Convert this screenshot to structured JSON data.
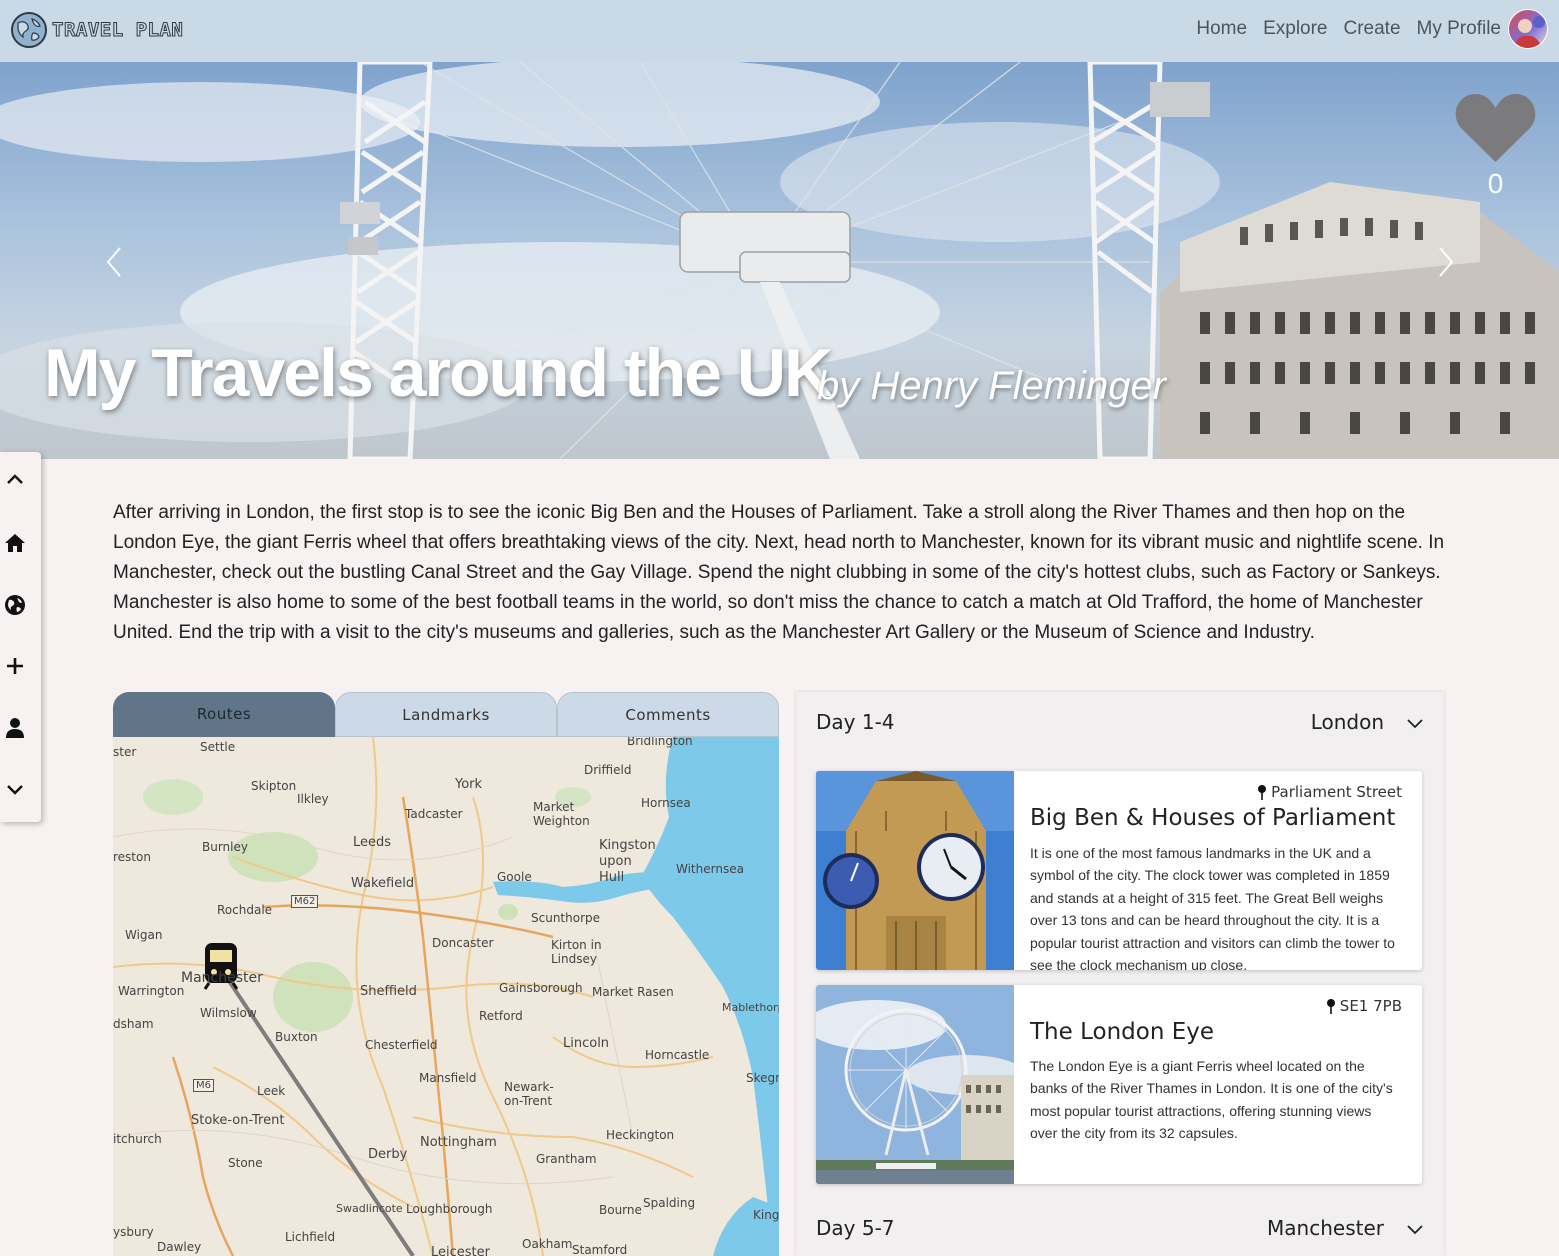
{
  "app": {
    "name": "TRAVEL PLAN"
  },
  "nav": {
    "home": "Home",
    "explore": "Explore",
    "create": "Create",
    "profile": "My Profile"
  },
  "hero": {
    "title": "My Travels around the UK",
    "author": "by Henry Fleminger",
    "likes": "0"
  },
  "description": "After arriving in London, the first stop is to see the iconic Big Ben and the Houses of Parliament. Take a stroll along the River Thames and then hop on the London Eye, the giant Ferris wheel that offers breathtaking views of the city. Next, head north to Manchester, known for its vibrant music and nightlife scene. In Manchester, check out the bustling Canal Street and the Gay Village. Spend the night clubbing in some of the city's hottest clubs, such as Factory or Sankeys. Manchester is also home to some of the best football teams in the world, so don't miss the chance to catch a match at Old Trafford, the home of Manchester United. End the trip with a visit to the city's museums and galleries, such as the Manchester Art Gallery or the Museum of Science and Industry.",
  "tabs": [
    "Routes",
    "Landmarks",
    "Comments"
  ],
  "map": {
    "labels": [
      "ster",
      "Settle",
      "Bridlington",
      "Driffield",
      "Skipton",
      "Ilkley",
      "York",
      "Market Weighton",
      "Hornsea",
      "Tadcaster",
      "Burnley",
      "Leeds",
      "Kingston upon Hull",
      "Withernsea",
      "reston",
      "Wakefield",
      "Goole",
      "M62",
      "Rochdale",
      "Scunthorpe",
      "Wigan",
      "Doncaster",
      "Kirton in Lindsey",
      "Manchester",
      "Warrington",
      "Sheffield",
      "Gainsborough",
      "Market Rasen",
      "dsham",
      "Wilmslow",
      "Retford",
      "Mablethorp",
      "Buxton",
      "Chesterfield",
      "Lincoln",
      "Horncastle",
      "M6",
      "Leek",
      "Mansfield",
      "Newark-on-Trent",
      "Skegn",
      "Stoke-on-Trent",
      "itchurch",
      "Nottingham",
      "Heckington",
      "Stone",
      "Derby",
      "Grantham",
      "Swadlincote",
      "Loughborough",
      "Bourne",
      "Spalding",
      "King",
      "Lichfield",
      "Oakham",
      "Stamford",
      "ysbury",
      "Dawley",
      "Leicester"
    ]
  },
  "itinerary": [
    {
      "day": "Day 1-4",
      "city": "London",
      "landmarks": [
        {
          "location": "Parliament Street",
          "title": "Big Ben & Houses of Parliament",
          "text": "It is one of the most famous landmarks in the UK and a symbol of the city. The clock tower was completed in 1859 and stands at a height of 315 feet. The Great Bell weighs over 13 tons and can be heard throughout the city. It is a popular tourist attraction and visitors can climb the tower to see the clock mechanism up close."
        },
        {
          "location": "SE1 7PB",
          "title": "The London Eye",
          "text": "The London Eye is a giant Ferris wheel located on the banks of the River Thames in London. It is one of the city's most popular tourist attractions, offering stunning views over the city from its 32 capsules."
        }
      ]
    },
    {
      "day": "Day 5-7",
      "city": "Manchester"
    }
  ],
  "colors": {
    "nav_bg": "#c9d9e5",
    "tab_active": "#617588",
    "tab_inactive": "#cbdae6",
    "page_bg": "#f7f1f1"
  },
  "icons": [
    "globe-logo-icon",
    "heart-icon",
    "chevron-left-icon",
    "chevron-right-icon",
    "chevron-up-icon",
    "home-icon",
    "globe-icon",
    "plus-icon",
    "user-icon",
    "chevron-down-icon",
    "map-pin-icon",
    "train-icon"
  ]
}
